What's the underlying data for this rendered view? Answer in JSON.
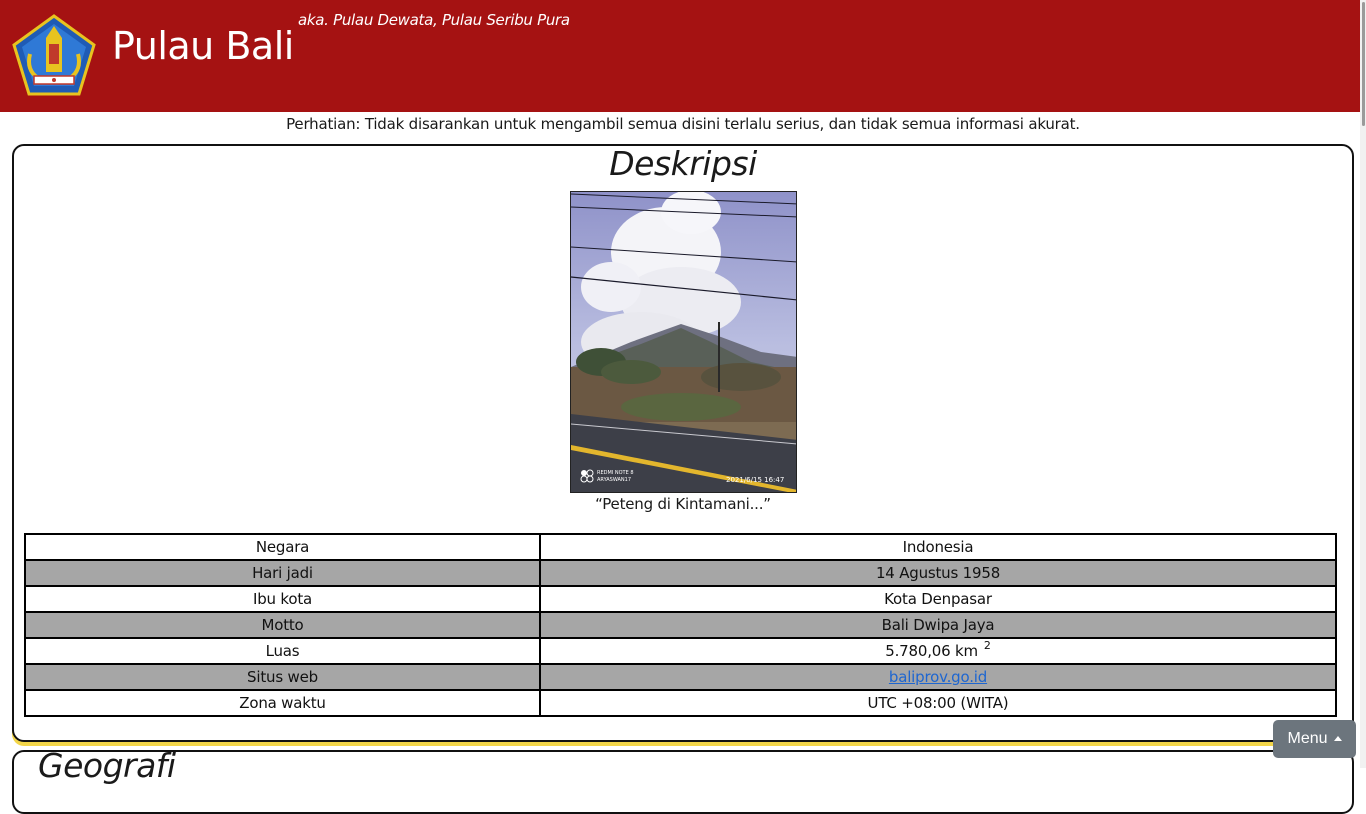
{
  "header": {
    "site_title": "Pulau Bali",
    "aka": "aka. Pulau Dewata, Pulau Seribu Pura",
    "header_color": "#a51212"
  },
  "notice": "Perhatian: Tidak disarankan untuk mengambil semua disini terlalu serius, dan tidak semua informasi akurat.",
  "description_section": {
    "title": "Deskripsi",
    "photo_overlay_left": "REDMI NOTE 8\nARYASWAN17",
    "photo_overlay_date": "2021/6/15  16:47",
    "caption": "“Peteng di Kintamani...”"
  },
  "info_table": {
    "rows": [
      {
        "label": "Negara",
        "value": "Indonesia"
      },
      {
        "label": "Hari jadi",
        "value": "14 Agustus 1958"
      },
      {
        "label": "Ibu kota",
        "value": "Kota Denpasar"
      },
      {
        "label": "Motto",
        "value": "Bali Dwipa Jaya"
      },
      {
        "label": "Luas",
        "value": "5.780,06 km",
        "sup": "2"
      },
      {
        "label": "Situs web",
        "value": "baliprov.go.id"
      },
      {
        "label": "Zona waktu",
        "value": "UTC +08:00 (WITA)"
      }
    ]
  },
  "next_section": {
    "title": "Geografi"
  },
  "menu_button": {
    "label": "Menu",
    "icon": "caret-up-icon"
  },
  "colors": {
    "accent_yellow": "#f3d64a",
    "link": "#1e66d0",
    "alt_row": "#a6a6a6"
  }
}
